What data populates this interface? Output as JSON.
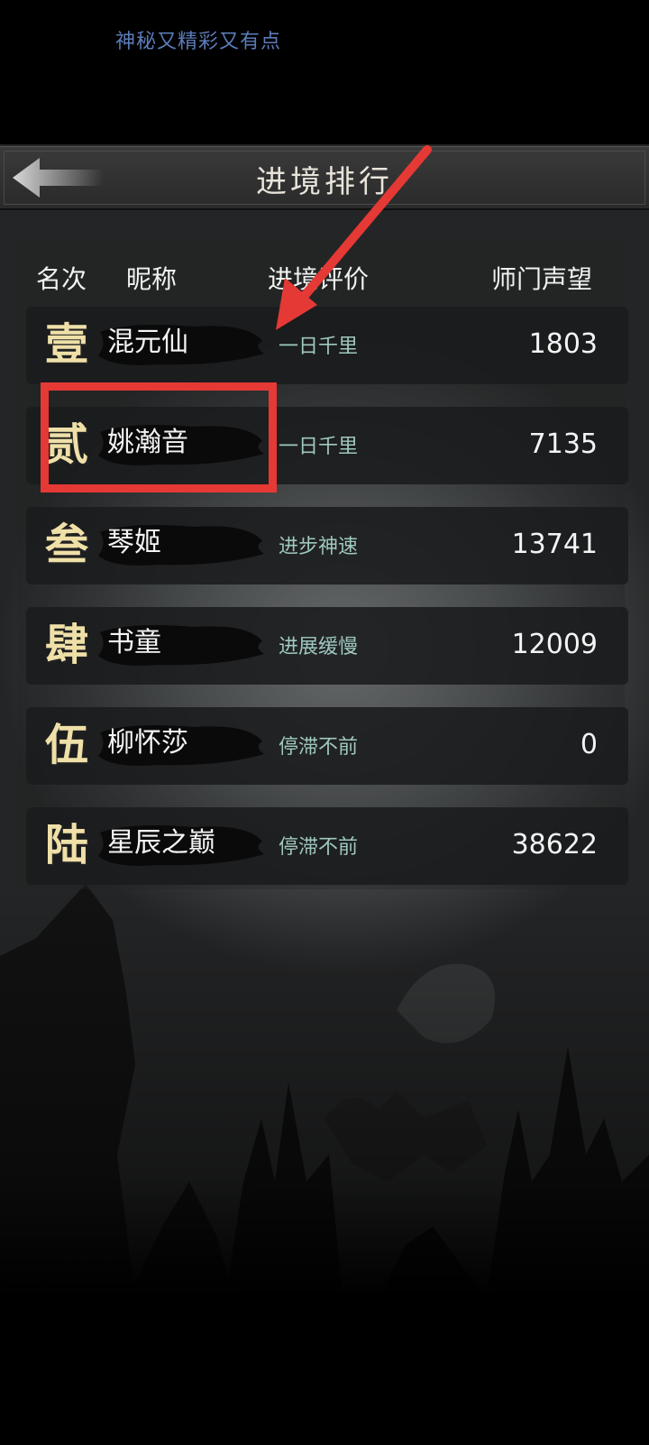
{
  "top_caption": "神秘又精彩又有点",
  "header": {
    "title": "进境排行",
    "back_icon": "back-arrow-icon"
  },
  "columns": {
    "rank": "名次",
    "nickname": "昵称",
    "evaluation": "进境评价",
    "reputation": "师门声望"
  },
  "rows": [
    {
      "rank": "壹",
      "nickname": "混元仙",
      "evaluation": "一日千里",
      "reputation": "1803"
    },
    {
      "rank": "贰",
      "nickname": "姚瀚音",
      "evaluation": "一日千里",
      "reputation": "7135"
    },
    {
      "rank": "叁",
      "nickname": "琴姬",
      "evaluation": "进步神速",
      "reputation": "13741"
    },
    {
      "rank": "肆",
      "nickname": "书童",
      "evaluation": "进展缓慢",
      "reputation": "12009"
    },
    {
      "rank": "伍",
      "nickname": "柳怀莎",
      "evaluation": "停滞不前",
      "reputation": "0"
    },
    {
      "rank": "陆",
      "nickname": "星辰之巅",
      "evaluation": "停滞不前",
      "reputation": "38622"
    }
  ],
  "colors": {
    "rank_glyph": "#efe0a8",
    "evaluation_text": "#9fc8c0",
    "annotation": "#e53935"
  }
}
